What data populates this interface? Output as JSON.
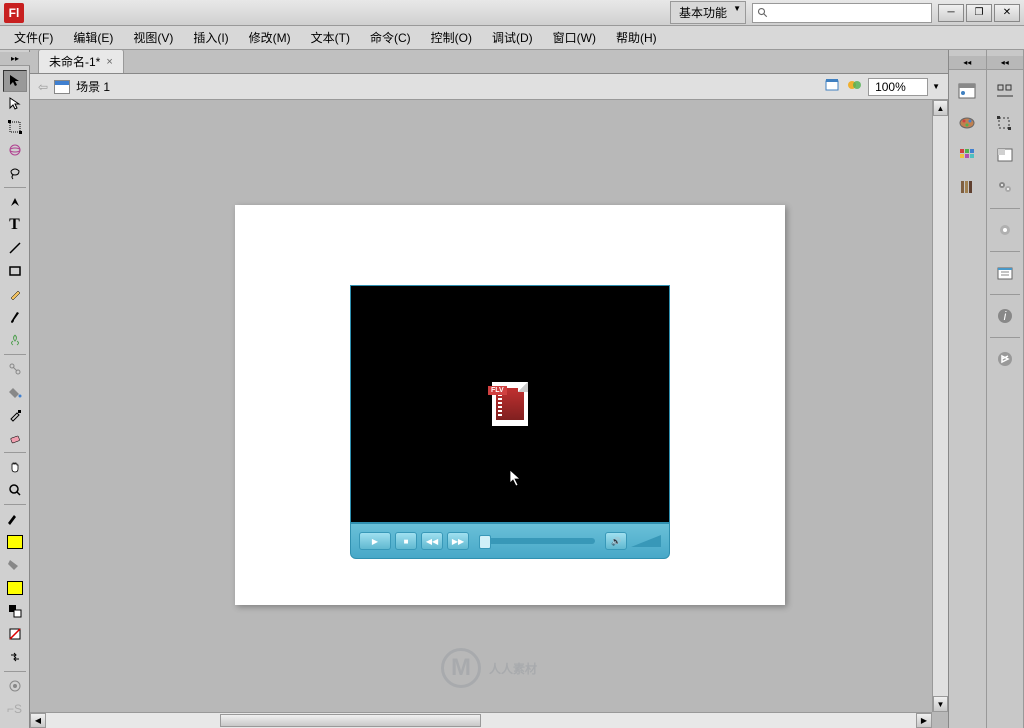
{
  "app": {
    "logo_text": "Fl"
  },
  "titlebar": {
    "workspace": "基本功能",
    "search_placeholder": ""
  },
  "menu": {
    "file": "文件(F)",
    "edit": "编辑(E)",
    "view": "视图(V)",
    "insert": "插入(I)",
    "modify": "修改(M)",
    "text": "文本(T)",
    "commands": "命令(C)",
    "control": "控制(O)",
    "debug": "调试(D)",
    "window": "窗口(W)",
    "help": "帮助(H)"
  },
  "document": {
    "tab_title": "未命名-1*",
    "scene_label": "场景 1",
    "zoom": "100%"
  },
  "video": {
    "format_label": "FLV"
  },
  "colors": {
    "stroke": "#000000",
    "fill": "#ffff00"
  },
  "watermark": {
    "text": "人人素材",
    "badge": "M"
  }
}
